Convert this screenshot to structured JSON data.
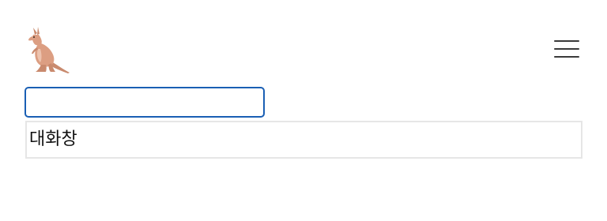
{
  "header": {
    "logo_icon": "kangaroo-icon",
    "menu_icon": "hamburger-menu-icon"
  },
  "input": {
    "value": "",
    "placeholder": ""
  },
  "chat": {
    "label": "대화창"
  },
  "colors": {
    "input_border": "#1a5fb4",
    "chat_border": "#e6e6e6",
    "logo": "#dc9e82"
  }
}
